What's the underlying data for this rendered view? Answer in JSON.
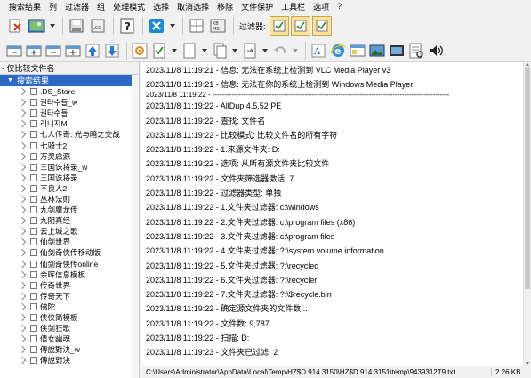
{
  "menu": [
    "搜索结果",
    "列",
    "过滤器",
    "组",
    "处理模式",
    "选择",
    "取消选择",
    "移除",
    "文件保护",
    "工具栏",
    "选项",
    "?"
  ],
  "toolbar": {
    "filter_label": "过滤器:"
  },
  "left_pane": {
    "header": "- 仅比较文件名",
    "root_label": "搜索结果",
    "items": [
      ".DS_Store",
      "권타수들_w",
      "권타수들",
      "리니지M",
      "七人传奇: 光与暗之交战",
      "七骑士2",
      "万灵启源",
      "三国诛将录_w",
      "三国诛将录",
      "不良人2",
      "丛林法则",
      "九剑魔龙传",
      "九阴真经",
      "云上城之歌",
      "仙剑世界",
      "仙剑奇侠传移动版",
      "仙剑奇侠传online",
      "余晖信息模板",
      "传奇世界",
      "传奇天下",
      "佛陀",
      "侠侠简模板",
      "侠剑狂歌",
      "倩女幽魂",
      "傳說對決_w",
      "傳說對決"
    ]
  },
  "log": [
    "2023/11/8 11:19:21 - 信息: 无法在系统上检测到 VLC Media Player v3",
    "2023/11/8 11:19:21 - 信息: 无法在你的系统上检测到 Windows Media Player",
    "2023/11/8 11:19:22 - ----------------------------------------------------------------------------------------------------",
    "2023/11/8 11:19:22 - AllDup 4.5.52 PE",
    "2023/11/8 11:19:22 - 查找: 文件名",
    "2023/11/8 11:19:22 - 比较模式: 比较文件名的所有字符",
    "2023/11/8 11:19:22 - 1.来源文件夹: D:",
    "2023/11/8 11:19:22 - 选项: 从所有源文件夹比较文件",
    "2023/11/8 11:19:22 - 文件夹筛选器激活: 7",
    "2023/11/8 11:19:22 - 过滤器类型: 单独",
    "2023/11/8 11:19:22 - 1.文件夹过滤器: c:\\windows",
    "2023/11/8 11:19:22 - 2.文件夹过滤器: c:\\program files (x86)",
    "2023/11/8 11:19:22 - 3.文件夹过滤器: c:\\program files",
    "2023/11/8 11:19:22 - 4.文件夹过滤器: ?:\\system volume information",
    "2023/11/8 11:19:22 - 5.文件夹过滤器: ?:\\recycled",
    "2023/11/8 11:19:22 - 6.文件夹过滤器: ?:\\recycler",
    "2023/11/8 11:19:22 - 7.文件夹过滤器: ?:\\$recycle.bin",
    "2023/11/8 11:19:22 - 确定源文件夹的文件数...",
    "2023/11/8 11:19:22 - 文件数: 9,787",
    "2023/11/8 11:19:22 - 扫描: D:",
    "2023/11/8 11:19:23 - 文件夹已过滤: 2"
  ],
  "status": {
    "path": "C:\\Users\\Administrator\\AppData\\Local\\Temp\\HZ$D.914.3150\\HZ$D.914.3151\\temp\\9439312T9.txt",
    "size": "2.26 KB"
  },
  "colors": {
    "selection": "#2b69c5",
    "toolbar_bg": "#f0f0f0"
  }
}
